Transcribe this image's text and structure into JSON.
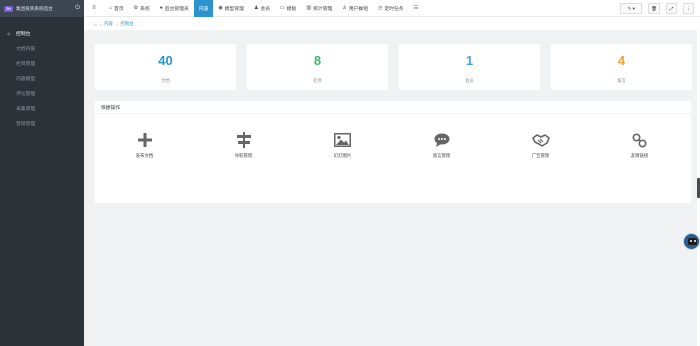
{
  "sidebar": {
    "title": "集团投资系统后台",
    "logo_text": "ZH",
    "items": [
      {
        "label": "控制台",
        "active": true,
        "icon": "home-icon"
      },
      {
        "label": "文档内容",
        "active": false,
        "icon": "file-icon",
        "has_children": true
      },
      {
        "label": "栏目管理",
        "active": false,
        "icon": "list-icon",
        "has_children": true
      },
      {
        "label": "内容模型",
        "active": false,
        "icon": "model-icon"
      },
      {
        "label": "评论管理",
        "active": false,
        "icon": "comment-icon"
      },
      {
        "label": "采集管理",
        "active": false,
        "icon": "collect-icon"
      },
      {
        "label": "营销管理",
        "active": false,
        "icon": "marketing-icon",
        "has_children": true
      }
    ]
  },
  "topnav": {
    "items": [
      {
        "label": "首页",
        "icon": "home-icon"
      },
      {
        "label": "系统",
        "icon": "gear-icon"
      },
      {
        "label": "后台管理员",
        "icon": "user-icon"
      },
      {
        "label": "内容",
        "icon": "",
        "active": true
      },
      {
        "label": "模型管理",
        "icon": "model-icon"
      },
      {
        "label": "会员",
        "icon": "members-icon"
      },
      {
        "label": "模板",
        "icon": "template-icon"
      },
      {
        "label": "统计管理",
        "icon": "chart-icon"
      },
      {
        "label": "用户群组",
        "icon": "group-icon"
      },
      {
        "label": "定时任务",
        "icon": "clock-icon"
      }
    ],
    "right_buttons": [
      {
        "label": "✎ ▾",
        "icon": "brush-icon"
      },
      {
        "label": "🗑",
        "icon": "trash-icon"
      },
      {
        "label": "⤢",
        "icon": "fullscreen-icon"
      },
      {
        "label": "⋮",
        "icon": "more-icon"
      }
    ]
  },
  "breadcrumb": {
    "items": [
      "内容",
      "控制台"
    ]
  },
  "stats": [
    {
      "value": "40",
      "label": "文档",
      "color": "#2d93cf"
    },
    {
      "value": "8",
      "label": "栏目",
      "color": "#3fb86b"
    },
    {
      "value": "1",
      "label": "会员",
      "color": "#45a2e6"
    },
    {
      "value": "4",
      "label": "留言",
      "color": "#e8a33c"
    }
  ],
  "quick": {
    "title": "快捷操作",
    "items": [
      {
        "label": "发布文档",
        "icon": "plus-icon"
      },
      {
        "label": "导航管理",
        "icon": "signpost-icon"
      },
      {
        "label": "幻灯图片",
        "icon": "image-icon"
      },
      {
        "label": "留言管理",
        "icon": "comment-icon"
      },
      {
        "label": "广告管理",
        "icon": "handshake-icon"
      },
      {
        "label": "友情链接",
        "icon": "link-icon"
      }
    ]
  }
}
